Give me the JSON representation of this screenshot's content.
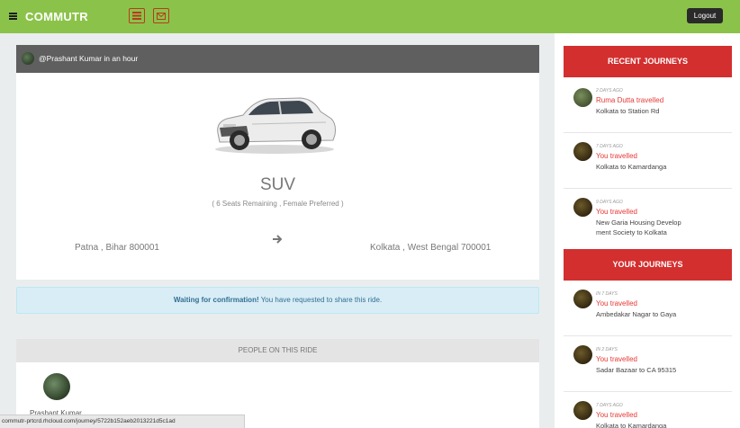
{
  "app": {
    "brand": "COMMUTR"
  },
  "toolbar": {
    "logout_label": "Logout"
  },
  "post": {
    "title": "@Prashant Kumar in an hour"
  },
  "ride": {
    "type": "SUV",
    "seats_info": "( 6 Seats Remaining , Female Preferred )",
    "from": "Patna , Bihar 800001",
    "to": "Kolkata , West Bengal 700001"
  },
  "alert": {
    "strong": "Waiting for confirmation!",
    "text": " You have requested to share this ride."
  },
  "people": {
    "heading": "PEOPLE ON THIS RIDE",
    "list": [
      {
        "name": "Prashant Kumar"
      }
    ]
  },
  "status": {
    "url": "commutr-prtcrd.rhcloud.com/journey/5722b152aeb2013221d5c1ad"
  },
  "sidebar": {
    "recent_heading": "RECENT JOURNEYS",
    "recent": [
      {
        "time": "2 DAYS AGO",
        "who": "Ruma Dutta travelled",
        "route": "Kolkata to Station Rd"
      },
      {
        "time": "7 DAYS AGO",
        "who": "You travelled",
        "route": "Kolkata to Kamardanga"
      },
      {
        "time": "9 DAYS AGO",
        "who": "You travelled",
        "route": "New Garia Housing Develop ment Society to Kolkata"
      }
    ],
    "yours_heading": "YOUR JOURNEYS",
    "yours": [
      {
        "time": "IN 7 DAYS",
        "who": "You travelled",
        "route": "Ambedakar Nagar to Gaya"
      },
      {
        "time": "IN 2 DAYS",
        "who": "You travelled",
        "route": "Sadar Bazaar to CA 95315"
      },
      {
        "time": "7 DAYS AGO",
        "who": "You travelled",
        "route": "Kolkata to Kamardanga"
      }
    ]
  },
  "colors": {
    "topbar": "#8bc34a",
    "accent": "#d32f2f",
    "link_red": "#e53935",
    "header_gray": "#5f5f5f"
  }
}
